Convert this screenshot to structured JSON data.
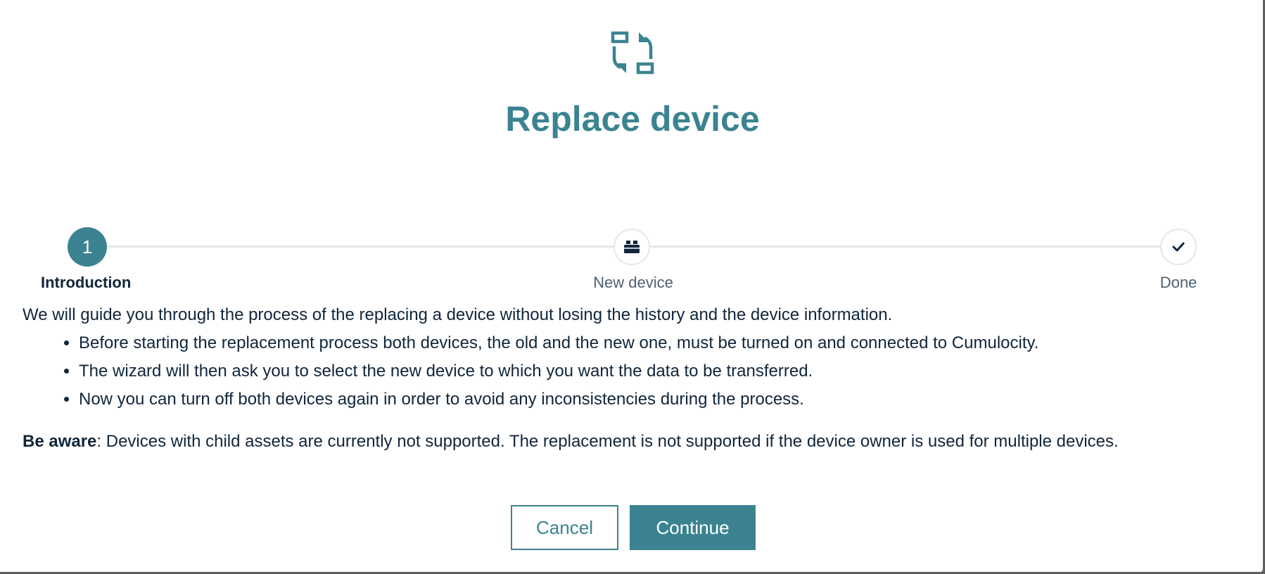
{
  "modal": {
    "title": "Replace device",
    "header_icon": "replace-device-icon"
  },
  "stepper": {
    "steps": [
      {
        "number": "1",
        "label": "Introduction",
        "state": "active"
      },
      {
        "icon": "device-icon",
        "label": "New device",
        "state": "pending"
      },
      {
        "icon": "check-icon",
        "label": "Done",
        "state": "pending"
      }
    ]
  },
  "content": {
    "intro": "We will guide you through the process of the replacing a device without losing the history and the device information.",
    "bullets": [
      "Before starting the replacement process both devices, the old and the new one, must be turned on and connected to Cumulocity.",
      "The wizard will then ask you to select the new device to which you want the data to be transferred.",
      "Now you can turn off both devices again in order to avoid any inconsistencies during the process."
    ],
    "aware_label": "Be aware",
    "aware_text": ": Devices with child assets are currently not supported. The replacement is not supported if the device owner is used for multiple devices."
  },
  "buttons": {
    "cancel": "Cancel",
    "continue": "Continue"
  },
  "colors": {
    "accent": "#3b8391",
    "text": "#10263b",
    "muted": "#4d6172",
    "line": "#e3e6ea"
  }
}
